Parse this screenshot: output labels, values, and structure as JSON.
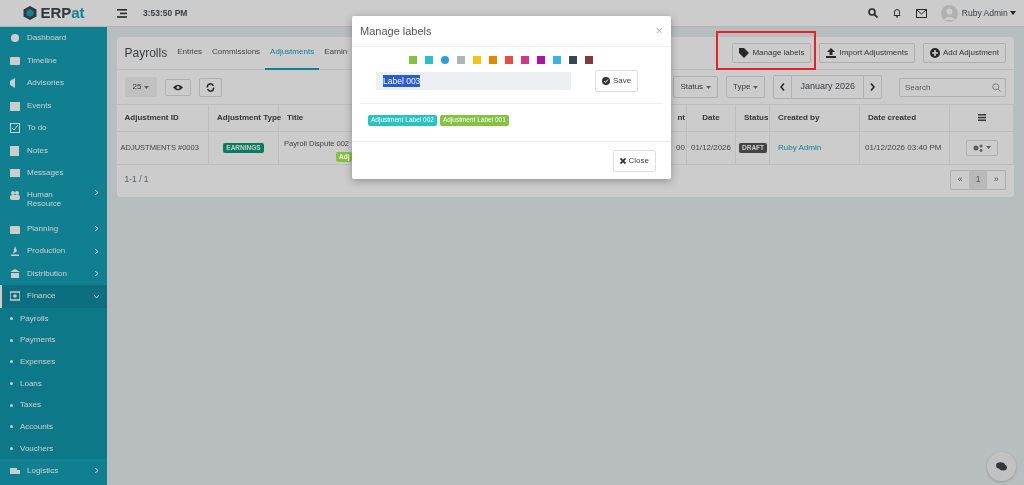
{
  "topbar": {
    "logo": {
      "part1": "ERP",
      "part2": "at"
    },
    "time": "3:53:50 PM",
    "user": "Ruby Admin"
  },
  "sidebar": {
    "items": [
      {
        "label": "Dashboard",
        "has_submenu": false,
        "expanded": false
      },
      {
        "label": "Timeline",
        "has_submenu": false,
        "expanded": false
      },
      {
        "label": "Advisories",
        "has_submenu": false,
        "expanded": false
      },
      {
        "label": "Events",
        "has_submenu": false,
        "expanded": false
      },
      {
        "label": "To do",
        "has_submenu": false,
        "expanded": false
      },
      {
        "label": "Notes",
        "has_submenu": false,
        "expanded": false
      },
      {
        "label": "Messages",
        "has_submenu": false,
        "expanded": false
      },
      {
        "label": "Human Resource",
        "has_submenu": true,
        "expanded": false
      },
      {
        "label": "Planning",
        "has_submenu": true,
        "expanded": false
      },
      {
        "label": "Production",
        "has_submenu": true,
        "expanded": false
      },
      {
        "label": "Distribution",
        "has_submenu": true,
        "expanded": false
      },
      {
        "label": "Finance",
        "has_submenu": true,
        "expanded": true,
        "children": [
          {
            "label": "Payrolls"
          },
          {
            "label": "Payments"
          },
          {
            "label": "Expenses"
          },
          {
            "label": "Loans"
          },
          {
            "label": "Taxes"
          },
          {
            "label": "Accounts"
          },
          {
            "label": "Vouchers"
          }
        ]
      },
      {
        "label": "Logistics",
        "has_submenu": true,
        "expanded": false
      }
    ]
  },
  "page": {
    "title": "Payrolls",
    "tabs": [
      {
        "label": "Entries",
        "selected": false
      },
      {
        "label": "Commissions",
        "selected": false
      },
      {
        "label": "Adjustments",
        "selected": true
      },
      {
        "label": "Earnin",
        "selected": false
      }
    ],
    "buttons": [
      {
        "label": "Manage labels",
        "highlighted": true
      },
      {
        "label": "Import Adjustments"
      },
      {
        "label": "Add Adjustment"
      }
    ],
    "page_size": "25",
    "filters": [
      "Status",
      "Type"
    ],
    "period": "January 2026",
    "search": {
      "placeholder": "Search"
    },
    "table": {
      "columns": [
        "Adjustment ID",
        "Adjustment Type",
        "Title",
        "nt",
        "Date",
        "Status",
        "Created by",
        "Date created"
      ],
      "rows": [
        {
          "id": "ADJUSTMENTS #0003",
          "type": "EARNINGS",
          "title": "Payroll Dispute 002",
          "label": {
            "text": "Adj",
            "color": "#83c340"
          },
          "amount": "00",
          "date": "01/12/2026",
          "status": "DRAFT",
          "created_by": "Ruby Admin",
          "date_created": "01/12/2026 03:40 PM"
        }
      ]
    },
    "summary": "1-1 / 1",
    "pagination": [
      {
        "label": "«",
        "selected": false
      },
      {
        "label": "1",
        "selected": true
      },
      {
        "label": "»",
        "selected": false
      }
    ]
  },
  "modal": {
    "title": "Manage labels",
    "close": "×",
    "colors": [
      {
        "color": "#83c340",
        "selected": false
      },
      {
        "color": "#29c2c2",
        "selected": false
      },
      {
        "color": "#2d9cdb",
        "selected": true
      },
      {
        "color": "#aab7b7",
        "selected": false
      },
      {
        "color": "#f1c40f",
        "selected": false
      },
      {
        "color": "#e18a00",
        "selected": false
      },
      {
        "color": "#e74c3c",
        "selected": false
      },
      {
        "color": "#d43480",
        "selected": false
      },
      {
        "color": "#ad159e",
        "selected": false
      },
      {
        "color": "#37b4e1",
        "selected": false
      },
      {
        "color": "#34495e",
        "selected": false
      },
      {
        "color": "#7e3b3a",
        "selected": false
      }
    ],
    "input": {
      "value": "Label 003",
      "selected_text": true
    },
    "save": "Save",
    "labels": [
      {
        "text": "Adjustment Label 002",
        "color": "#29c2c2"
      },
      {
        "text": "Adjustment Label 001",
        "color": "#83c340"
      }
    ],
    "close_button": "Close"
  }
}
